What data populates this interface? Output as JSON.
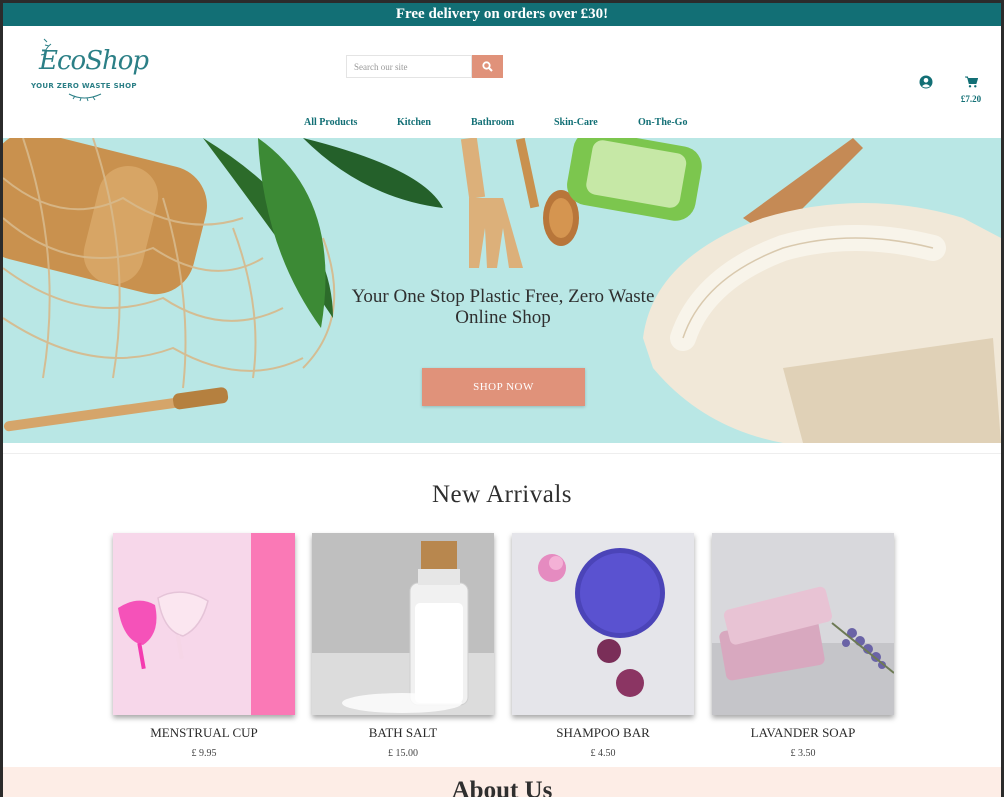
{
  "announcement": "Free delivery on orders over £30!",
  "logo": {
    "title": "EcoShop",
    "subtitle": "YOUR ZERO WASTE SHOP"
  },
  "search": {
    "placeholder": "Search our site",
    "icon": "search-icon"
  },
  "account": {
    "icon": "user-circle-icon"
  },
  "cart": {
    "icon": "cart-icon",
    "total": "£7.20"
  },
  "nav": {
    "items": [
      {
        "label": "All Products"
      },
      {
        "label": "Kitchen"
      },
      {
        "label": "Bathroom"
      },
      {
        "label": "Skin-Care"
      },
      {
        "label": "On-The-Go"
      }
    ]
  },
  "hero": {
    "title_line1": "Your One Stop Plastic Free, Zero Waste",
    "title_line2": "Online Shop",
    "button": "SHOP NOW"
  },
  "arrivals": {
    "title": "New Arrivals",
    "products": [
      {
        "name": "MENSTRUAL CUP",
        "price": "£ 9.95"
      },
      {
        "name": "BATH SALT",
        "price": "£ 15.00"
      },
      {
        "name": "SHAMPOO BAR",
        "price": "£ 4.50"
      },
      {
        "name": "LAVANDER SOAP",
        "price": "£ 3.50"
      }
    ]
  },
  "about": {
    "title": "About Us"
  },
  "colors": {
    "brand": "#126f75",
    "accent": "#e0927a",
    "hero_bg": "#b9e7e5",
    "about_bg": "#fdede6"
  }
}
